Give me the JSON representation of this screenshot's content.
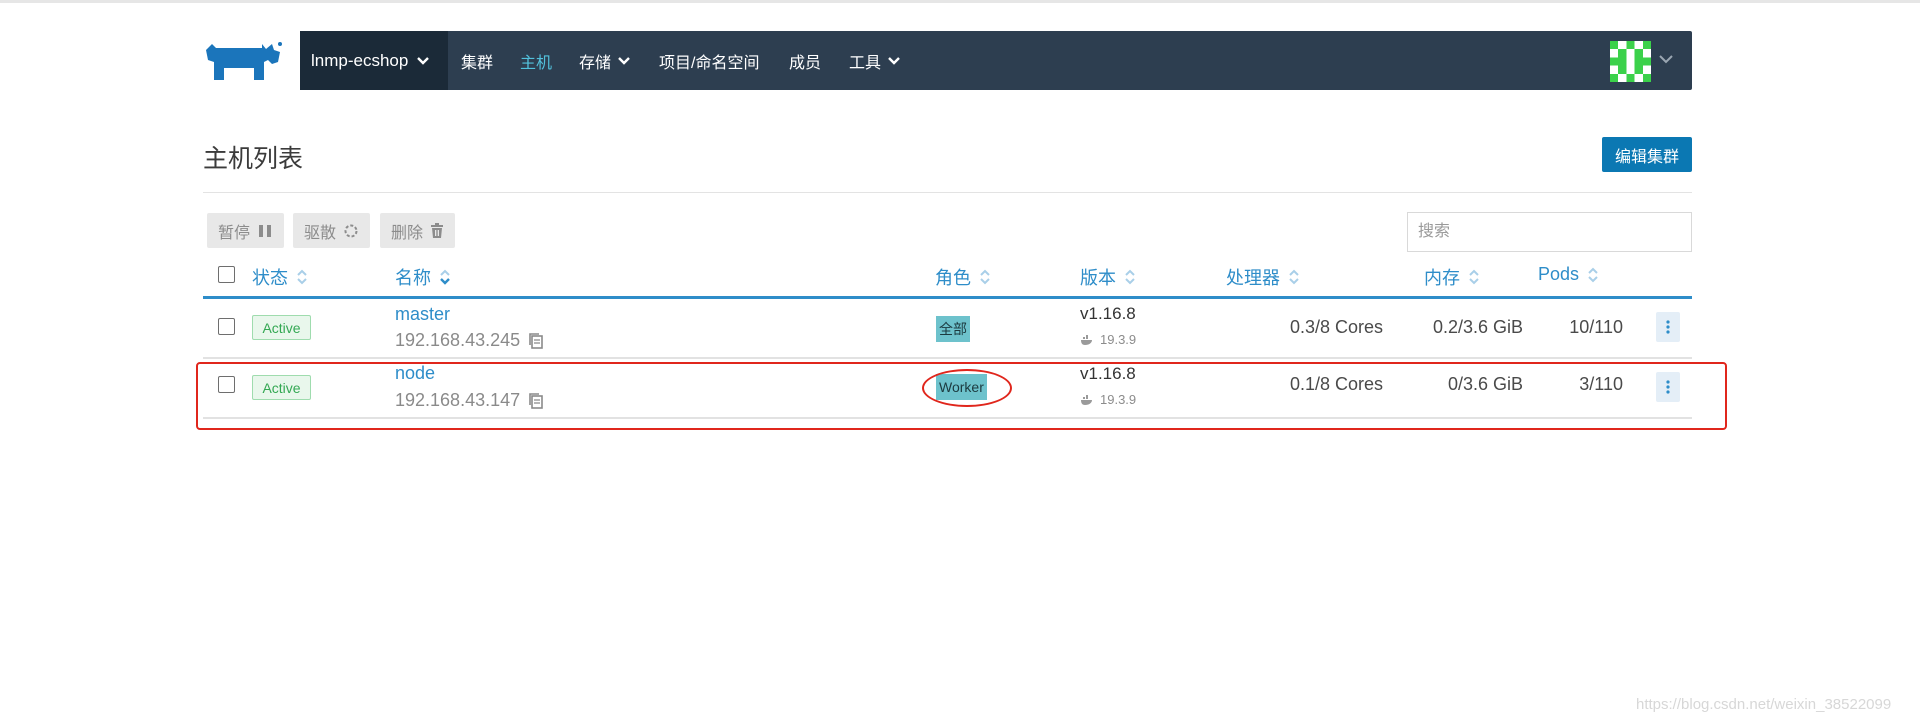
{
  "header": {
    "cluster_name": "lnmp-ecshop",
    "nav": [
      {
        "label": "集群",
        "active": false,
        "dropdown": false
      },
      {
        "label": "主机",
        "active": true,
        "dropdown": false
      },
      {
        "label": "存储",
        "active": false,
        "dropdown": true
      },
      {
        "label": "项目/命名空间",
        "active": false,
        "dropdown": false
      },
      {
        "label": "成员",
        "active": false,
        "dropdown": false
      },
      {
        "label": "工具",
        "active": false,
        "dropdown": true
      }
    ],
    "brand_color": "#0b78b3",
    "nav_bg": "#2d3e50"
  },
  "page": {
    "title": "主机列表",
    "edit_cluster_label": "编辑集群"
  },
  "actions": {
    "pause_label": "暂停",
    "drain_label": "驱散",
    "delete_label": "删除",
    "search_placeholder": "搜索"
  },
  "table": {
    "columns": {
      "state": "状态",
      "name": "名称",
      "roles": "角色",
      "version": "版本",
      "cpu": "处理器",
      "memory": "内存",
      "pods": "Pods"
    },
    "rows": [
      {
        "state": "Active",
        "name": "master",
        "ip": "192.168.43.245",
        "role": "全部",
        "kube_version": "v1.16.8",
        "docker_version": "19.3.9",
        "cpu": "0.3/8 Cores",
        "memory": "0.2/3.6 GiB",
        "pods": "10/110"
      },
      {
        "state": "Active",
        "name": "node",
        "ip": "192.168.43.147",
        "role": "Worker",
        "kube_version": "v1.16.8",
        "docker_version": "19.3.9",
        "cpu": "0.1/8 Cores",
        "memory": "0/3.6 GiB",
        "pods": "3/110"
      }
    ]
  },
  "watermark": "https://blog.csdn.net/weixin_38522099"
}
